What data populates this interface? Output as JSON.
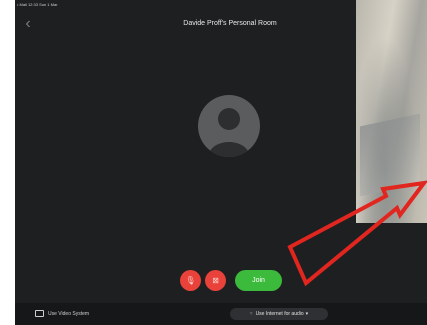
{
  "status_bar": {
    "text": "• Mail  12:33  Sun 1 Mar"
  },
  "header": {
    "title": "Davide Proff's Personal Room",
    "back_icon": "chevron-left-icon"
  },
  "avatar": {
    "icon": "person-silhouette-icon"
  },
  "controls": {
    "mic_icon": "microphone-muted-icon",
    "video_icon": "video-off-icon",
    "join_label": "Join"
  },
  "bottom_bar": {
    "video_system_label": "Use Video System",
    "audio_label": "Use Internet for audio",
    "audio_caret": "▾"
  },
  "colors": {
    "background": "#1e1f21",
    "join_green": "#3cba3c",
    "control_red": "#e9423a",
    "annotation_red": "#e0261f"
  }
}
